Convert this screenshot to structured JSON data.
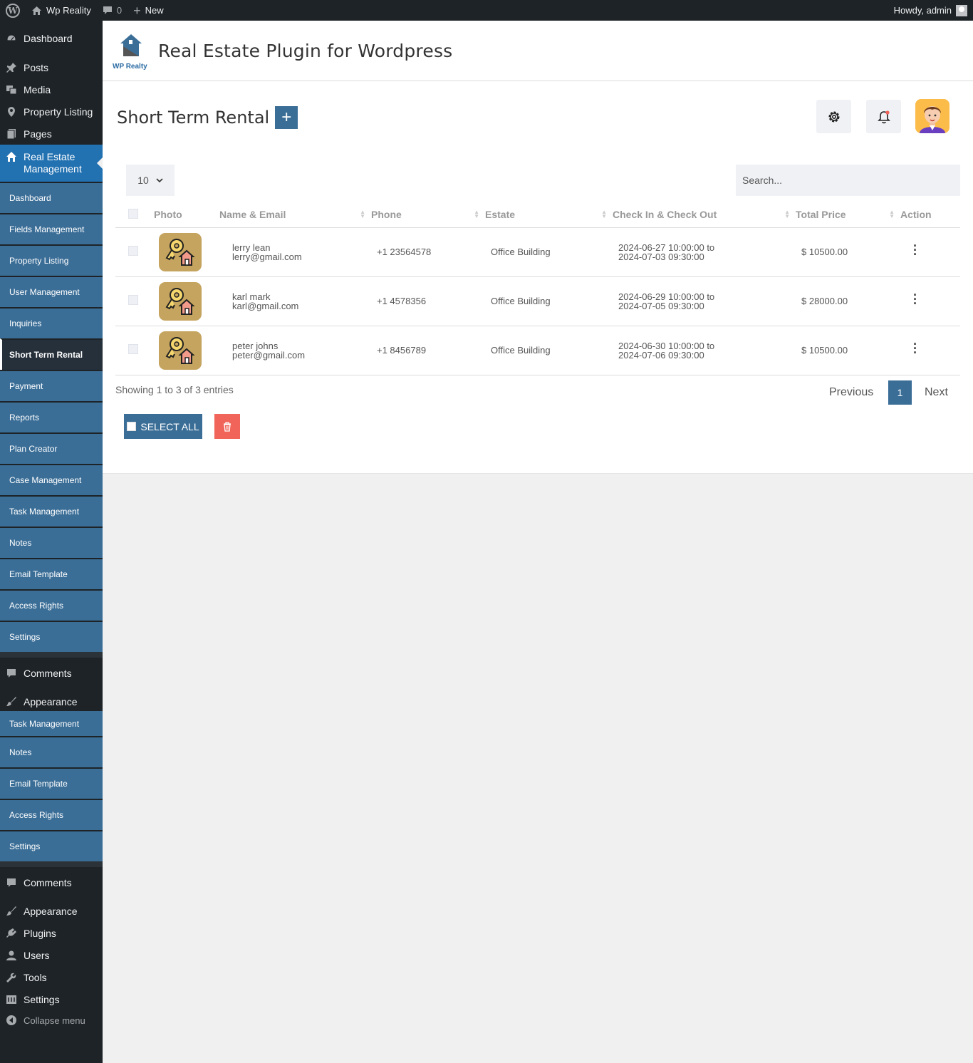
{
  "adminbar": {
    "site_name": "Wp Reality",
    "comments_count": "0",
    "new_label": "New",
    "howdy": "Howdy, admin"
  },
  "sidebar": {
    "top_items": [
      {
        "label": "Dashboard",
        "icon": "dashboard-icon"
      },
      {
        "label": "Posts",
        "icon": "pin-icon"
      },
      {
        "label": "Media",
        "icon": "media-icon"
      },
      {
        "label": "Property Listing",
        "icon": "location-icon"
      },
      {
        "label": "Pages",
        "icon": "pages-icon"
      },
      {
        "label": "Real Estate Management",
        "icon": "home-icon"
      }
    ],
    "sub_items": [
      "Dashboard",
      "Fields Management",
      "Property Listing",
      "User Management",
      "Inquiries",
      "Short Term Rental",
      "Payment",
      "Reports",
      "Plan Creator",
      "Case Management",
      "Task Management",
      "Notes",
      "Email Template",
      "Access Rights",
      "Settings"
    ],
    "mid_items": [
      {
        "label": "Comments",
        "icon": "comment-icon"
      },
      {
        "label": "Appearance",
        "icon": "brush-icon"
      }
    ],
    "repeat_sub_items": [
      "Task Management",
      "Notes",
      "Email Template",
      "Access Rights",
      "Settings"
    ],
    "bottom_items": [
      {
        "label": "Comments",
        "icon": "comment-icon"
      },
      {
        "label": "Appearance",
        "icon": "brush-icon"
      },
      {
        "label": "Plugins",
        "icon": "plugin-icon"
      },
      {
        "label": "Users",
        "icon": "user-icon"
      },
      {
        "label": "Tools",
        "icon": "wrench-icon"
      },
      {
        "label": "Settings",
        "icon": "settings-icon"
      }
    ],
    "collapse": "Collapse menu"
  },
  "brand": {
    "logo_text": "WP Realty",
    "title": "Real Estate Plugin for Wordpress"
  },
  "page": {
    "title": "Short Term Rental",
    "add_label": "+"
  },
  "table": {
    "length_value": "10",
    "search_placeholder": "Search...",
    "headers": [
      "Photo",
      "Name & Email",
      "Phone",
      "Estate",
      "Check In & Check Out",
      "Total Price",
      "Action"
    ],
    "rows": [
      {
        "name": "lerry lean",
        "email": "lerry@gmail.com",
        "phone": "+1 23564578",
        "estate": "Office Building",
        "checkin": "2024-06-27 10:00:00 to",
        "checkout": "2024-07-03 09:30:00",
        "price": "$ 10500.00"
      },
      {
        "name": "karl mark",
        "email": "karl@gmail.com",
        "phone": "+1 4578356",
        "estate": "Office Building",
        "checkin": "2024-06-29 10:00:00 to",
        "checkout": "2024-07-05 09:30:00",
        "price": "$ 28000.00"
      },
      {
        "name": "peter johns",
        "email": "peter@gmail.com",
        "phone": "+1 8456789",
        "estate": "Office Building",
        "checkin": "2024-06-30 10:00:00 to",
        "checkout": "2024-07-06 09:30:00",
        "price": "$ 10500.00"
      }
    ],
    "info": "Showing 1 to 3 of 3 entries",
    "previous": "Previous",
    "page": "1",
    "next": "Next"
  },
  "actions": {
    "select_all": "SELECT ALL"
  },
  "colors": {
    "accent": "#3b6e97",
    "admin_dark": "#1d2327",
    "current_menu": "#2271b1",
    "delete": "#f0645a",
    "avatar_bg": "#fcbc4a",
    "photo_bg": "#c5a45f"
  }
}
